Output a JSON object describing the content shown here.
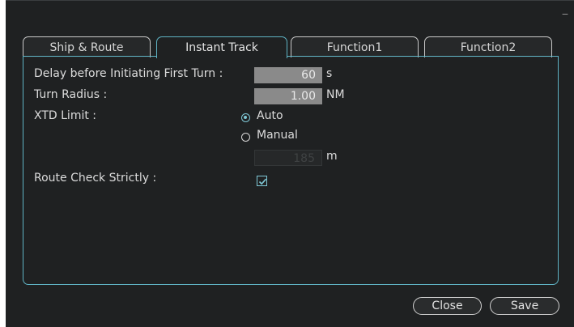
{
  "window": {
    "close_glyph": "×",
    "min_glyph": "_"
  },
  "tabs": [
    {
      "label": "Ship & Route",
      "active": false
    },
    {
      "label": "Instant Track",
      "active": true
    },
    {
      "label": "Function1",
      "active": false
    },
    {
      "label": "Function2",
      "active": false
    }
  ],
  "form": {
    "delay_label": "Delay before Initiating First Turn :",
    "delay_value": "60",
    "delay_unit": "s",
    "turn_radius_label": "Turn Radius :",
    "turn_radius_value": "1.00",
    "turn_radius_unit": "NM",
    "xtd_label": "XTD Limit :",
    "xtd_selected": "Auto",
    "xtd_option_auto": "Auto",
    "xtd_option_manual": "Manual",
    "xtd_manual_value": "185",
    "xtd_manual_unit": "m",
    "route_check_label": "Route Check Strictly :",
    "route_check_checked": true
  },
  "buttons": {
    "close": "Close",
    "save": "Save"
  },
  "colors": {
    "background": "#1f2122",
    "accent": "#5fb3c4",
    "field_fill": "#8a8a8a",
    "text": "#dcdcdc"
  }
}
